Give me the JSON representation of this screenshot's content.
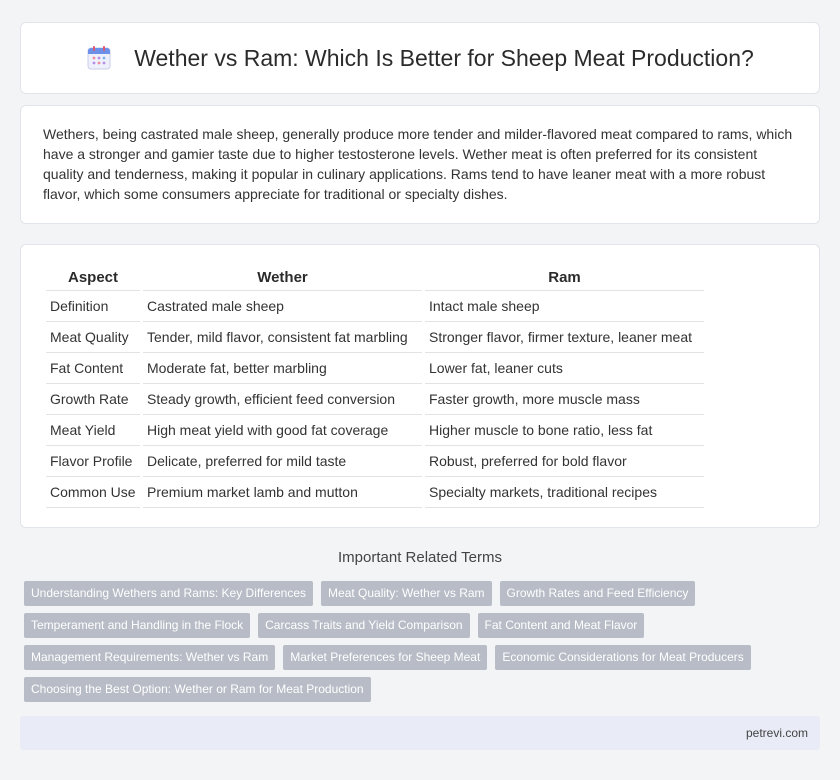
{
  "header": {
    "icon": "calendar-icon",
    "title": "Wether vs Ram: Which Is Better for Sheep Meat Production?"
  },
  "intro": {
    "text": "Wethers, being castrated male sheep, generally produce more tender and milder-flavored meat compared to rams, which have a stronger and gamier taste due to higher testosterone levels. Wether meat is often preferred for its consistent quality and tenderness, making it popular in culinary applications. Rams tend to have leaner meat with a more robust flavor, which some consumers appreciate for traditional or specialty dishes."
  },
  "table": {
    "headers": [
      "Aspect",
      "Wether",
      "Ram"
    ],
    "rows": [
      [
        "Definition",
        "Castrated male sheep",
        "Intact male sheep"
      ],
      [
        "Meat Quality",
        "Tender, mild flavor, consistent fat marbling",
        "Stronger flavor, firmer texture, leaner meat"
      ],
      [
        "Fat Content",
        "Moderate fat, better marbling",
        "Lower fat, leaner cuts"
      ],
      [
        "Growth Rate",
        "Steady growth, efficient feed conversion",
        "Faster growth, more muscle mass"
      ],
      [
        "Meat Yield",
        "High meat yield with good fat coverage",
        "Higher muscle to bone ratio, less fat"
      ],
      [
        "Flavor Profile",
        "Delicate, preferred for mild taste",
        "Robust, preferred for bold flavor"
      ],
      [
        "Common Use",
        "Premium market lamb and mutton",
        "Specialty markets, traditional recipes"
      ]
    ]
  },
  "related": {
    "title": "Important Related Terms",
    "tags": [
      [
        "Understanding Wethers and Rams: Key Differences",
        "Meat Quality: Wether vs Ram",
        "Growth Rates and Feed Efficiency"
      ],
      [
        "Temperament and Handling in the Flock",
        "Carcass Traits and Yield Comparison",
        "Fat Content and Meat Flavor"
      ],
      [
        "Management Requirements: Wether vs Ram",
        "Market Preferences for Sheep Meat",
        "Economic Considerations for Meat Producers"
      ],
      [
        "Choosing the Best Option: Wether or Ram for Meat Production"
      ]
    ]
  },
  "footer": {
    "site": "petrevi.com"
  }
}
